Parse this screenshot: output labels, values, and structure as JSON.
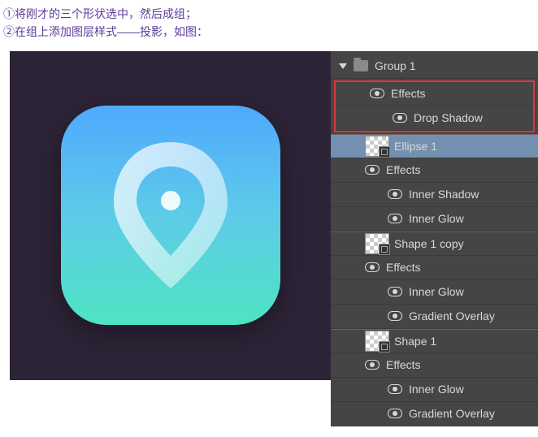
{
  "instructions": {
    "line1": "①将刚才的三个形状选中，然后成组；",
    "line2": "②在组上添加图层样式——投影，如图："
  },
  "panel": {
    "group_name": "Group 1",
    "effects_label": "Effects",
    "drop_shadow": "Drop Shadow",
    "ellipse1": "Ellipse 1",
    "inner_shadow": "Inner Shadow",
    "inner_glow": "Inner Glow",
    "shape1_copy": "Shape 1 copy",
    "gradient_overlay": "Gradient Overlay",
    "shape1": "Shape 1"
  }
}
